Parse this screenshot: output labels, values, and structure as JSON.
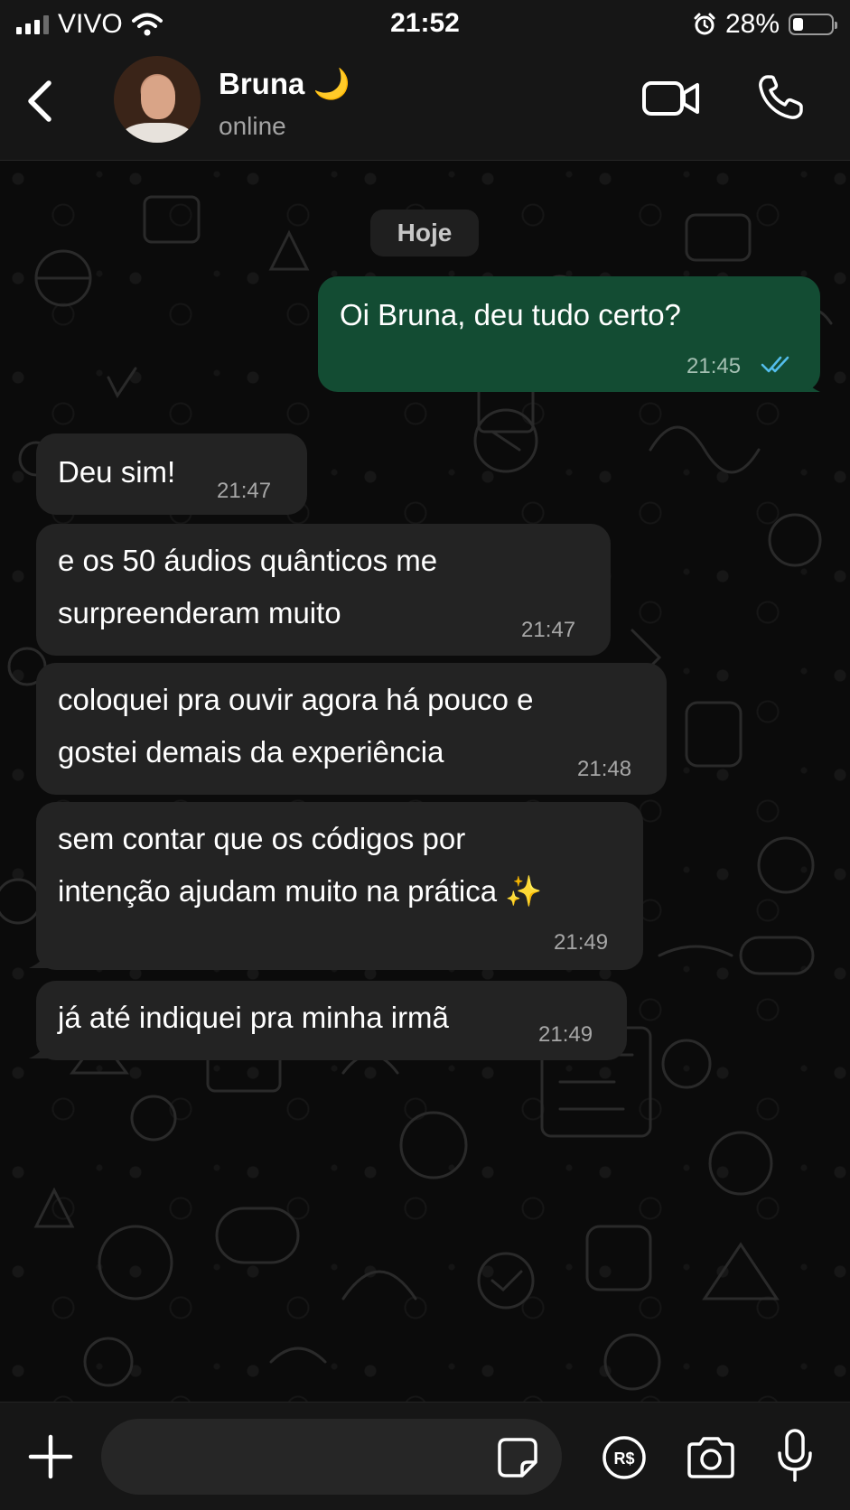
{
  "status_bar": {
    "carrier": "VIVO",
    "time": "21:52",
    "battery": "28%",
    "battery_level": 0.28
  },
  "header": {
    "contact_name": "Bruna 🌙",
    "status": "online"
  },
  "chat": {
    "date_label": "Hoje",
    "messages": [
      {
        "direction": "outgoing",
        "text": "Oi Bruna, deu tudo certo?",
        "time": "21:45",
        "read": true
      },
      {
        "direction": "incoming",
        "lines": [
          "Deu sim!"
        ],
        "time": "21:47"
      },
      {
        "direction": "incoming",
        "lines": [
          "e os 50 áudios quânticos me",
          "surpreenderam muito"
        ],
        "time": "21:47"
      },
      {
        "direction": "incoming",
        "lines": [
          "coloquei pra ouvir agora há pouco e",
          "gostei demais da experiência"
        ],
        "time": "21:48"
      },
      {
        "direction": "incoming",
        "lines": [
          "sem contar que os códigos por",
          "intenção ajudam muito na prática ✨"
        ],
        "time": "21:49"
      },
      {
        "direction": "incoming",
        "lines": [
          "já até indiquei pra minha irmã"
        ],
        "time": "21:49"
      }
    ]
  },
  "composer": {
    "input_value": ""
  },
  "icons": {
    "back": "chevron-left-icon",
    "video": "video-camera-icon",
    "call": "phone-icon",
    "plus": "plus-icon",
    "sticker": "sticker-icon",
    "payment": "payment-icon",
    "camera": "camera-icon",
    "mic": "microphone-icon"
  },
  "colors": {
    "outgoing_bubble": "#134c33",
    "incoming_bubble": "#232323",
    "read_ticks": "#53bdeb",
    "background": "#0b0b0b"
  }
}
